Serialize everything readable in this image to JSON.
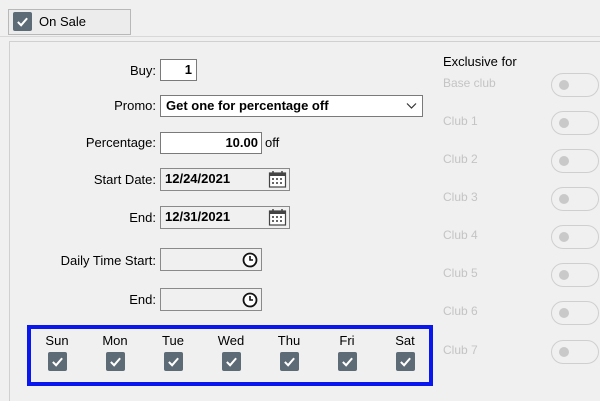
{
  "on_sale": {
    "label": "On Sale",
    "checked": true
  },
  "fields": {
    "buy_label": "Buy:",
    "buy_value": "1",
    "promo_label": "Promo:",
    "promo_value": "Get one for percentage off",
    "percentage_label": "Percentage:",
    "percentage_value": "10.00",
    "percentage_unit": "off",
    "start_date_label": "Start Date:",
    "start_date_value": "12/24/2021",
    "end_date_label": "End:",
    "end_date_value": "12/31/2021",
    "daily_time_start_label": "Daily Time Start:",
    "daily_time_start_value": "",
    "daily_time_end_label": "End:",
    "daily_time_end_value": ""
  },
  "days": [
    {
      "name": "Sun",
      "checked": true
    },
    {
      "name": "Mon",
      "checked": true
    },
    {
      "name": "Tue",
      "checked": true
    },
    {
      "name": "Wed",
      "checked": true
    },
    {
      "name": "Thu",
      "checked": true
    },
    {
      "name": "Fri",
      "checked": true
    },
    {
      "name": "Sat",
      "checked": true
    }
  ],
  "exclusive": {
    "title": "Exclusive for",
    "clubs": [
      {
        "name": "Base club",
        "on": false
      },
      {
        "name": "Club 1",
        "on": false
      },
      {
        "name": "Club 2",
        "on": false
      },
      {
        "name": "Club 3",
        "on": false
      },
      {
        "name": "Club 4",
        "on": false
      },
      {
        "name": "Club 5",
        "on": false
      },
      {
        "name": "Club 6",
        "on": false
      },
      {
        "name": "Club 7",
        "on": false
      }
    ]
  },
  "colors": {
    "checkbox": "#5d6b76",
    "highlight_border": "#0a16ee",
    "disabled_text": "#c4c4c4"
  },
  "icons": {
    "check": "check-icon",
    "dropdown": "chevron-down-icon",
    "calendar": "calendar-icon",
    "clock": "clock-icon"
  }
}
